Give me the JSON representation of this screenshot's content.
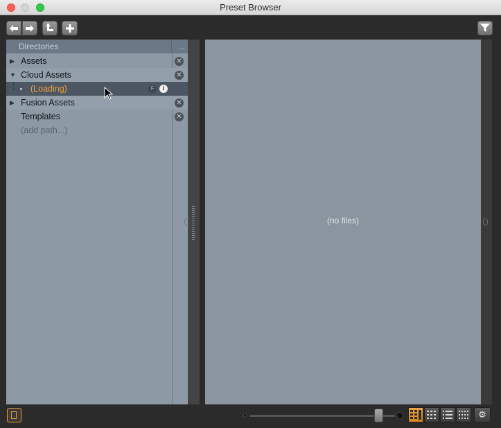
{
  "window": {
    "title": "Preset Browser"
  },
  "toolbar": {
    "back_icon": "arrow-left-icon",
    "forward_icon": "arrow-right-icon",
    "up_icon": "parent-directory-icon",
    "add_icon": "plus-icon",
    "filter_icon": "filter-funnel-icon"
  },
  "directories": {
    "header": "Directories",
    "menu": "...",
    "items": [
      {
        "label": "Assets",
        "expanded": false
      },
      {
        "label": "Cloud Assets",
        "expanded": true
      },
      {
        "label": "(Loading)",
        "child": true,
        "selected": true,
        "badge_f": "F",
        "badge_i": "i"
      },
      {
        "label": "Fusion Assets",
        "expanded": false
      },
      {
        "label": "Templates"
      },
      {
        "label": "(add path...)"
      }
    ]
  },
  "files": {
    "empty_text": "(no files)"
  },
  "bottom": {
    "view_modes": [
      "large-icons-view",
      "small-icons-view",
      "list-view",
      "thumbnail-grid-view"
    ],
    "active_view": 0
  },
  "colors": {
    "accent": "#e99a2c",
    "loading_text": "#f0a23a"
  }
}
